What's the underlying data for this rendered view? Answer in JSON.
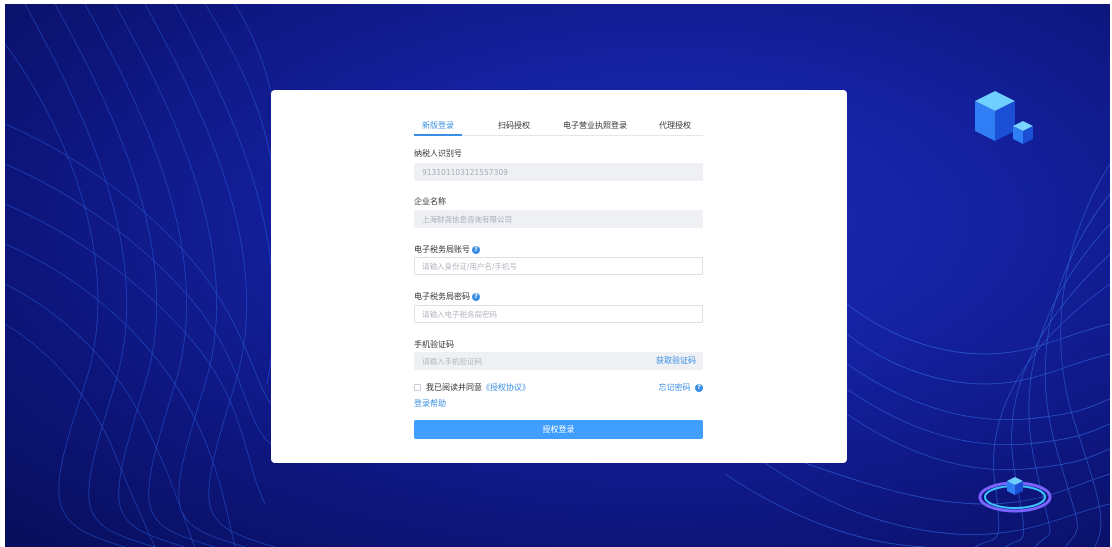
{
  "tabs": [
    {
      "label": "新版登录",
      "active": true
    },
    {
      "label": "扫码授权",
      "active": false
    },
    {
      "label": "电子营业执照登录",
      "active": false
    },
    {
      "label": "代理授权",
      "active": false
    }
  ],
  "form": {
    "taxpayer_id": {
      "label": "纳税人识别号",
      "value": "913101103121557309"
    },
    "company_name": {
      "label": "企业名称",
      "value": "上海财尧信息咨询有限公司"
    },
    "account": {
      "label": "电子税务局账号",
      "placeholder": "请输入身份证/用户名/手机号"
    },
    "password": {
      "label": "电子税务局密码",
      "placeholder": "请输入电子税务局密码"
    },
    "sms_code": {
      "label": "手机验证码",
      "placeholder": "请输入手机验证码",
      "get_code": "获取验证码"
    }
  },
  "agreement": {
    "text": "我已阅读并同意",
    "link": "《授权协议》",
    "forgot": "忘记密码"
  },
  "login_help": "登录帮助",
  "submit_label": "授权登录",
  "help_glyph": "?",
  "colors": {
    "accent": "#409eff",
    "link": "#3a8ee6",
    "background_dark": "#0d157a",
    "background_light": "#1c2bb6"
  },
  "icons": [
    "question-circle-icon",
    "cube-decoration-icon",
    "ring-decoration-icon"
  ]
}
